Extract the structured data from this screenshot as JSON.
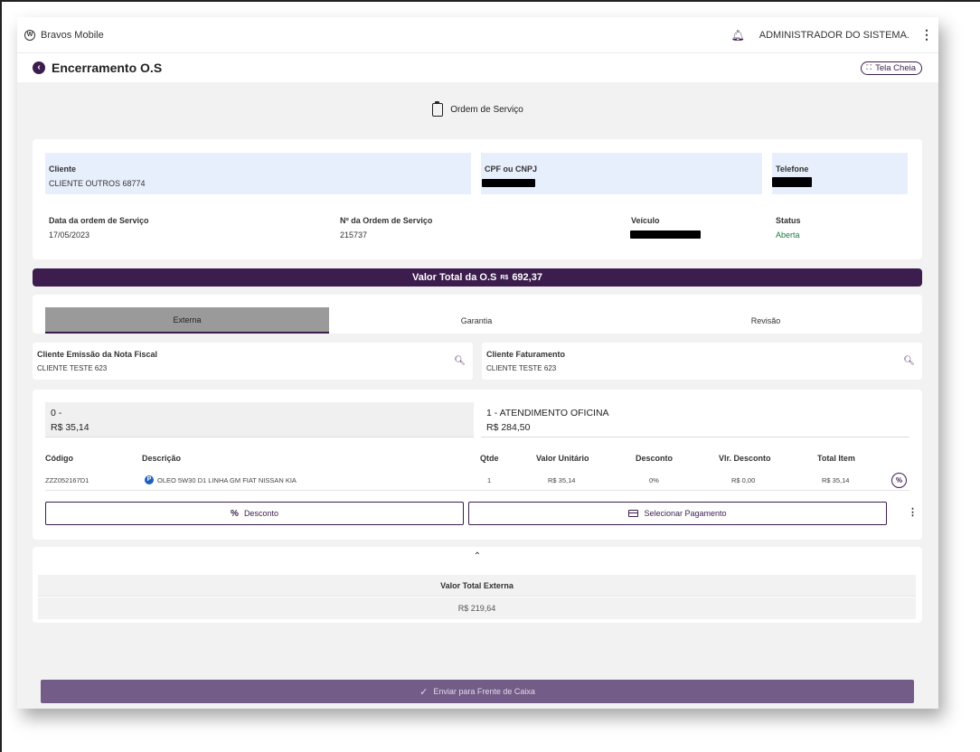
{
  "app": {
    "brand": "Bravos Mobile",
    "user": "ADMINISTRADOR DO SISTEMA."
  },
  "titlebar": {
    "title": "Encerramento O.S",
    "fullscreen_label": "Tela Cheia"
  },
  "section": {
    "title": "Ordem de Serviço"
  },
  "info": {
    "cliente_label": "Cliente",
    "cliente_value": "CLIENTE OUTROS 68774",
    "cpf_label": "CPF ou CNPJ",
    "telefone_label": "Telefone",
    "data_label": "Data da ordem de Serviço",
    "data_value": "17/05/2023",
    "numero_label": "Nº da Ordem de Serviço",
    "numero_value": "215737",
    "veiculo_label": "Veículo",
    "status_label": "Status",
    "status_value": "Aberta"
  },
  "total": {
    "label": "Valor Total da O.S",
    "currency": "R$",
    "value": "692,37"
  },
  "tabs": [
    {
      "label": "Externa",
      "active": true
    },
    {
      "label": "Garantia",
      "active": false
    },
    {
      "label": "Revisão",
      "active": false
    }
  ],
  "nota_fiscal": {
    "label": "Cliente Emissão da Nota Fiscal",
    "value": "CLIENTE TESTE 623"
  },
  "faturamento": {
    "label": "Cliente Faturamento",
    "value": "CLIENTE TESTE 623"
  },
  "summary": {
    "left": {
      "line1": "0 -",
      "line2": "R$ 35,14"
    },
    "right": {
      "line1": "1 - ATENDIMENTO OFICINA",
      "line2": "R$ 284,50"
    }
  },
  "table": {
    "headers": {
      "codigo": "Código",
      "descricao": "Descrição",
      "qtde": "Qtde",
      "valor_unitario": "Valor Unitário",
      "desconto": "Desconto",
      "vlr_desconto": "Vlr. Desconto",
      "total_item": "Total Item"
    },
    "rows": [
      {
        "codigo": "ZZZ052167D1",
        "badge": "P",
        "descricao": "OLEO 5W30 D1 LINHA GM FIAT NISSAN KIA",
        "qtde": "1",
        "valor_unitario": "R$ 35,14",
        "desconto": "0%",
        "vlr_desconto": "R$ 0,00",
        "total_item": "R$ 35,14"
      }
    ]
  },
  "actions": {
    "desconto_label": "Desconto",
    "pagamento_label": "Selecionar Pagamento"
  },
  "externa": {
    "label": "Valor Total Externa",
    "value": "R$ 219,64"
  },
  "footer": {
    "send_label": "Enviar para Frente de Caixa"
  },
  "colors": {
    "primary": "#3c1d4d",
    "send_button": "#735c87",
    "status_green": "#1f7a45",
    "highlight": "#e8effc"
  },
  "icons": [
    "vw-logo-icon",
    "bell-icon",
    "kebab-menu-icon",
    "back-arrow-icon",
    "fullscreen-icon",
    "clipboard-icon",
    "search-icon",
    "percent-icon",
    "credit-card-icon",
    "chevron-up-icon",
    "check-icon"
  ]
}
